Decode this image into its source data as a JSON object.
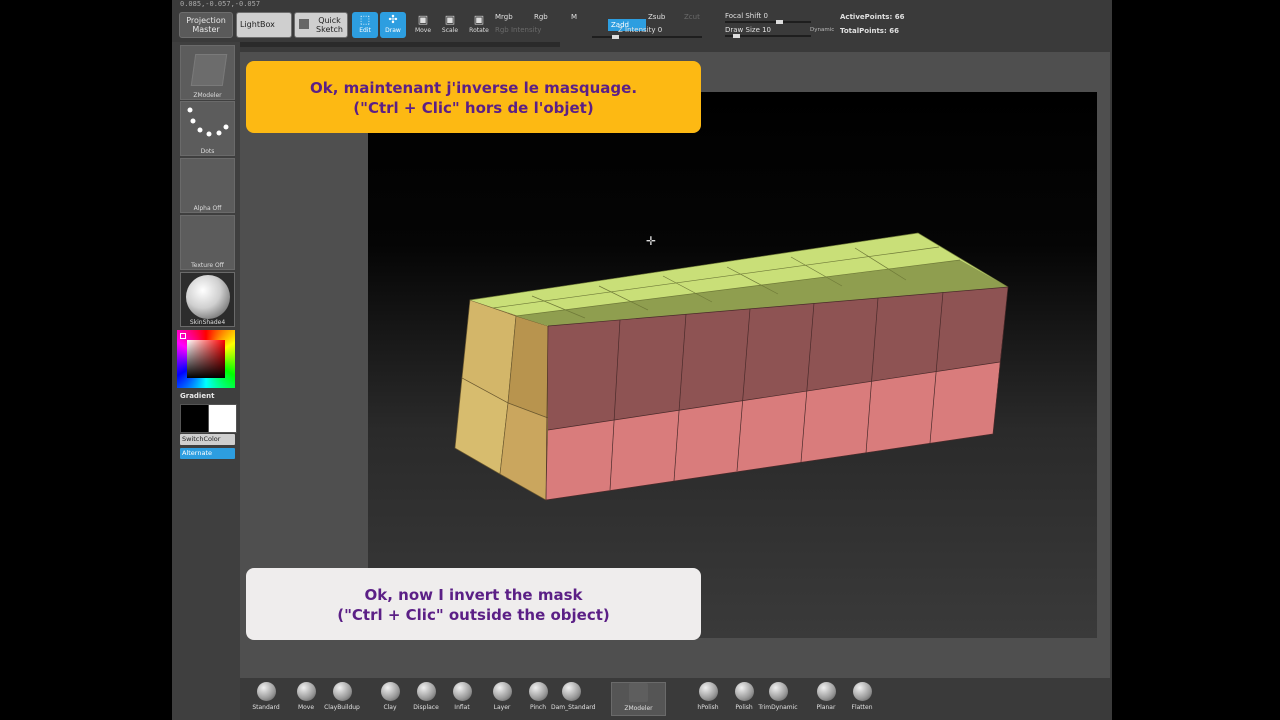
{
  "status_coords": "0.085,-0.057,-0.057",
  "toolbar": {
    "projection_master": "Projection Master",
    "lightbox": "LightBox",
    "quick_sketch": "Quick Sketch",
    "edit": "Edit",
    "draw": "Draw",
    "move": "Move",
    "scale": "Scale",
    "rotate": "Rotate",
    "mrgb": "Mrgb",
    "rgb": "Rgb",
    "m": "M",
    "rgb_intensity": "Rgb Intensity",
    "zadd": "Zadd",
    "zsub": "Zsub",
    "zcut": "Zcut",
    "z_intensity": "Z Intensity 0",
    "focal_shift": "Focal Shift 0",
    "draw_size": "Draw Size 10",
    "dynamic": "Dynamic",
    "active_points": "ActivePoints: 66",
    "total_points": "TotalPoints: 66"
  },
  "shelf": {
    "zmodeler": "ZModeler",
    "dots": "Dots",
    "alpha": "Alpha Off",
    "texture": "Texture Off",
    "material": "SkinShade4",
    "gradient": "Gradient",
    "switchcolor": "SwitchColor",
    "alternate": "Alternate"
  },
  "brushes": [
    "Standard",
    "Move",
    "ClayBuildup",
    "Clay",
    "Displace",
    "Inflat",
    "Layer",
    "Pinch",
    "Dam_Standard",
    "ZModeler",
    "hPolish",
    "Polish",
    "TrimDynamic",
    "Planar",
    "Flatten"
  ],
  "callouts": {
    "french_line1": "Ok, maintenant j'inverse le masquage.",
    "french_line2": "(\"Ctrl + Clic\" hors de l'objet)",
    "english_line1": "Ok, now I invert the mask",
    "english_line2": "(\"Ctrl + Clic\" outside the object)"
  },
  "colors": {
    "accent_blue": "#2d9ee0",
    "french_callout_bg": "#fdb913",
    "english_callout_bg": "#efeded",
    "callout_text": "#5b1f86",
    "mesh_unmasked_top": "#c9df78",
    "mesh_masked": "#8e5353"
  }
}
